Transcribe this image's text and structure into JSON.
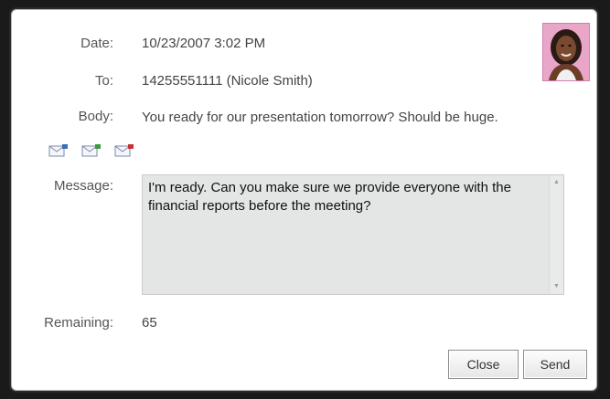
{
  "fields": {
    "date_label": "Date:",
    "date_value": "10/23/2007 3:02 PM",
    "to_label": "To:",
    "to_value": "14255551111 (Nicole Smith)",
    "body_label": "Body:",
    "body_value": "You ready for our presentation tomorrow? Should be huge.",
    "message_label": "Message:",
    "message_value": "I'm ready. Can you make sure we provide everyone with the financial reports before the meeting?",
    "remaining_label": "Remaining:",
    "remaining_value": "65"
  },
  "attachments": [
    {
      "icon": "attachment-blue-icon",
      "color": "#3a6fb5"
    },
    {
      "icon": "attachment-green-icon",
      "color": "#3c9a3c"
    },
    {
      "icon": "attachment-red-icon",
      "color": "#c33333"
    }
  ],
  "buttons": {
    "close_label": "Close",
    "send_label": "Send"
  },
  "colors": {
    "avatar_background": "#e9a6c9",
    "message_background": "#e4e6e6"
  }
}
